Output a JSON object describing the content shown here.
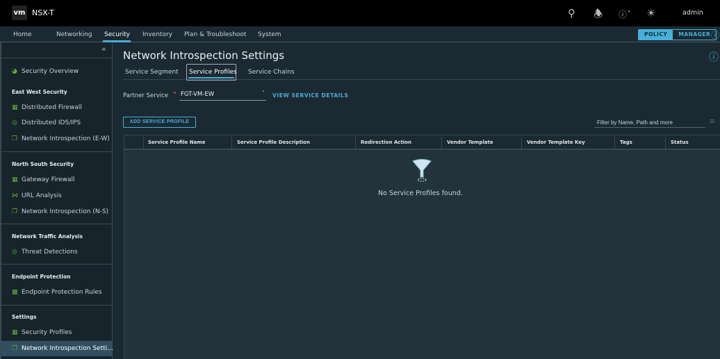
{
  "header": {
    "logo": "vm",
    "app": "NSX-T",
    "user": "admin",
    "icons": [
      "search-icon",
      "bell-icon",
      "help-icon",
      "sun-icon"
    ]
  },
  "nav": {
    "items": [
      "Home",
      "Networking",
      "Security",
      "Inventory",
      "Plan & Troubleshoot",
      "System"
    ],
    "policy": "POLICY",
    "manager": "MANAGER"
  },
  "sidebar": {
    "overview": "Security Overview",
    "sections": [
      {
        "title": "East West Security",
        "items": [
          "Distributed Firewall",
          "Distributed IDS/IPS",
          "Network Introspection (E-W)"
        ]
      },
      {
        "title": "North South Security",
        "items": [
          "Gateway Firewall",
          "URL Analysis",
          "Network Introspection (N-S)"
        ]
      },
      {
        "title": "Network Traffic Analysis",
        "items": [
          "Threat Detections"
        ]
      },
      {
        "title": "Endpoint Protection",
        "items": [
          "Endpoint Protection Rules"
        ]
      },
      {
        "title": "Settings",
        "items": [
          "Security Profiles",
          "Network Introspection Setti..."
        ]
      }
    ]
  },
  "main": {
    "title": "Network Introspection Settings",
    "tabs": [
      "Service Segment",
      "Service Profiles",
      "Service Chains"
    ],
    "partner_label": "Partner Service",
    "partner_value": "FGT-VM-EW",
    "view_details": "VIEW SERVICE DETAILS",
    "add_button": "ADD SERVICE PROFILE",
    "filter_placeholder": "Filter by Name, Path and more",
    "columns": [
      "Service Profile Name",
      "Service Profile Description",
      "Redirection Action",
      "Vendor Template",
      "Vendor Template Key",
      "Tags",
      "Status"
    ],
    "empty": "No Service Profiles found."
  },
  "colors": {
    "accent": "#49afd9",
    "icon_green": "#5fae3c"
  }
}
